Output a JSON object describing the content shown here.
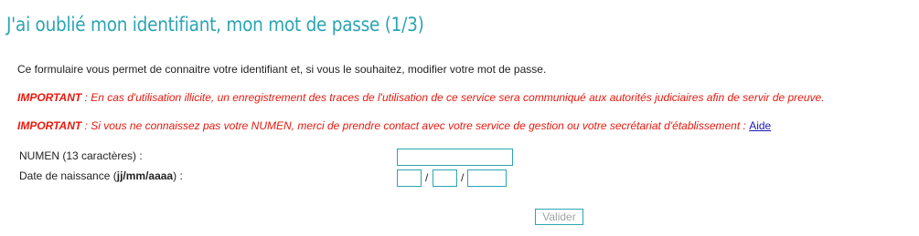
{
  "page": {
    "title": "J'ai oublié mon identifiant, mon mot de passe (1/3)"
  },
  "intro": {
    "text": "Ce formulaire vous permet de connaitre votre identifiant et, si vous le souhaitez, modifier votre mot de passe."
  },
  "warnings": [
    {
      "label": "IMPORTANT",
      "text": " : En cas d'utilisation illicite, un enregistrement des traces de l'utilisation de ce service sera communiqué aux autorités judiciaires afin de servir de preuve."
    },
    {
      "label": "IMPORTANT",
      "text": " : Si vous ne connaissez pas votre NUMEN, merci de prendre contact avec votre service de gestion ou votre secrétariat d'établissement : ",
      "link_text": "Aide"
    }
  ],
  "form": {
    "numen_label": "NUMEN (13 caractères) :",
    "numen_value": "",
    "dob_label_prefix": "Date de naissance (",
    "dob_label_format": "jj/mm/aaaa",
    "dob_label_suffix": ") :",
    "day_value": "",
    "month_value": "",
    "year_value": "",
    "separator": "/",
    "submit_label": "Valider"
  },
  "colors": {
    "accent": "#2aa5b3",
    "warning": "#e8190e",
    "link": "#1d16b5",
    "disabled_text": "#9fa3a4"
  }
}
